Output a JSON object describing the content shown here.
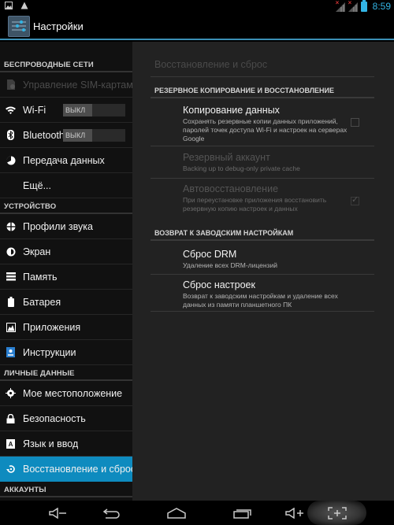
{
  "status_bar": {
    "left_icons": [
      "gallery-notification-icon",
      "warning-icon"
    ],
    "right_icons": [
      "signal-no-sim-icon",
      "signal-no-sim-icon",
      "battery-icon"
    ],
    "time": "8:59",
    "accent_color": "#33b5e5"
  },
  "action_bar": {
    "app_icon": "settings-sliders-icon",
    "title": "Настройки"
  },
  "sidebar": {
    "sections": [
      {
        "header": "БЕСПРОВОДНЫЕ СЕТИ",
        "items": [
          {
            "label": "Управление SIM-картами",
            "icon": "sim-card-icon",
            "disabled": true
          },
          {
            "label": "Wi-Fi",
            "icon": "wifi-icon",
            "toggle": "ВЫКЛ"
          },
          {
            "label": "Bluetooth",
            "icon": "bluetooth-icon",
            "toggle": "ВЫКЛ"
          },
          {
            "label": "Передача данных",
            "icon": "data-usage-icon"
          },
          {
            "label": "Ещё...",
            "icon": ""
          }
        ]
      },
      {
        "header": "УСТРОЙСТВО",
        "items": [
          {
            "label": "Профили звука",
            "icon": "sound-profile-icon"
          },
          {
            "label": "Экран",
            "icon": "display-icon"
          },
          {
            "label": "Память",
            "icon": "storage-icon"
          },
          {
            "label": "Батарея",
            "icon": "battery-icon"
          },
          {
            "label": "Приложения",
            "icon": "apps-icon"
          },
          {
            "label": "Инструкции",
            "icon": "instructions-icon"
          }
        ]
      },
      {
        "header": "ЛИЧНЫЕ ДАННЫЕ",
        "items": [
          {
            "label": "Мое местоположение",
            "icon": "location-icon"
          },
          {
            "label": "Безопасность",
            "icon": "lock-icon"
          },
          {
            "label": "Язык и ввод",
            "icon": "language-icon"
          },
          {
            "label": "Восстановление и сброс",
            "icon": "backup-restore-icon",
            "selected": true
          }
        ]
      },
      {
        "header": "АККАУНТЫ",
        "items": []
      }
    ],
    "selected_color": "#0e8bbf"
  },
  "content": {
    "title": "Восстановление и сброс",
    "categories": [
      {
        "header": "РЕЗЕРВНОЕ КОПИРОВАНИЕ И ВОССТАНОВЛЕНИЕ",
        "prefs": [
          {
            "title": "Копирование данных",
            "summary": "Сохранять резервные копии данных приложений, паролей точек доступа Wi-Fi и настроек на серверах Google",
            "checkbox": false
          },
          {
            "title": "Резервный аккаунт",
            "summary": "Backing up to debug-only private cache",
            "disabled": true
          },
          {
            "title": "Автовосстановление",
            "summary": "При переустановке приложения восстановить резервную копию настроек и данных",
            "checkbox": true,
            "disabled": true
          }
        ]
      },
      {
        "header": "ВОЗВРАТ К ЗАВОДСКИМ НАСТРОЙКАМ",
        "prefs": [
          {
            "title": "Сброс DRM",
            "summary": "Удаление всех DRM-лицензий"
          },
          {
            "title": "Сброс настроек",
            "summary": "Возврат к заводским настройкам и удаление всех данных из памяти планшетного ПК"
          }
        ]
      }
    ]
  },
  "nav_bar": {
    "buttons": [
      "volume-down-icon",
      "back-icon",
      "home-icon",
      "recent-apps-icon",
      "volume-up-icon",
      "screenshot-icon"
    ]
  }
}
